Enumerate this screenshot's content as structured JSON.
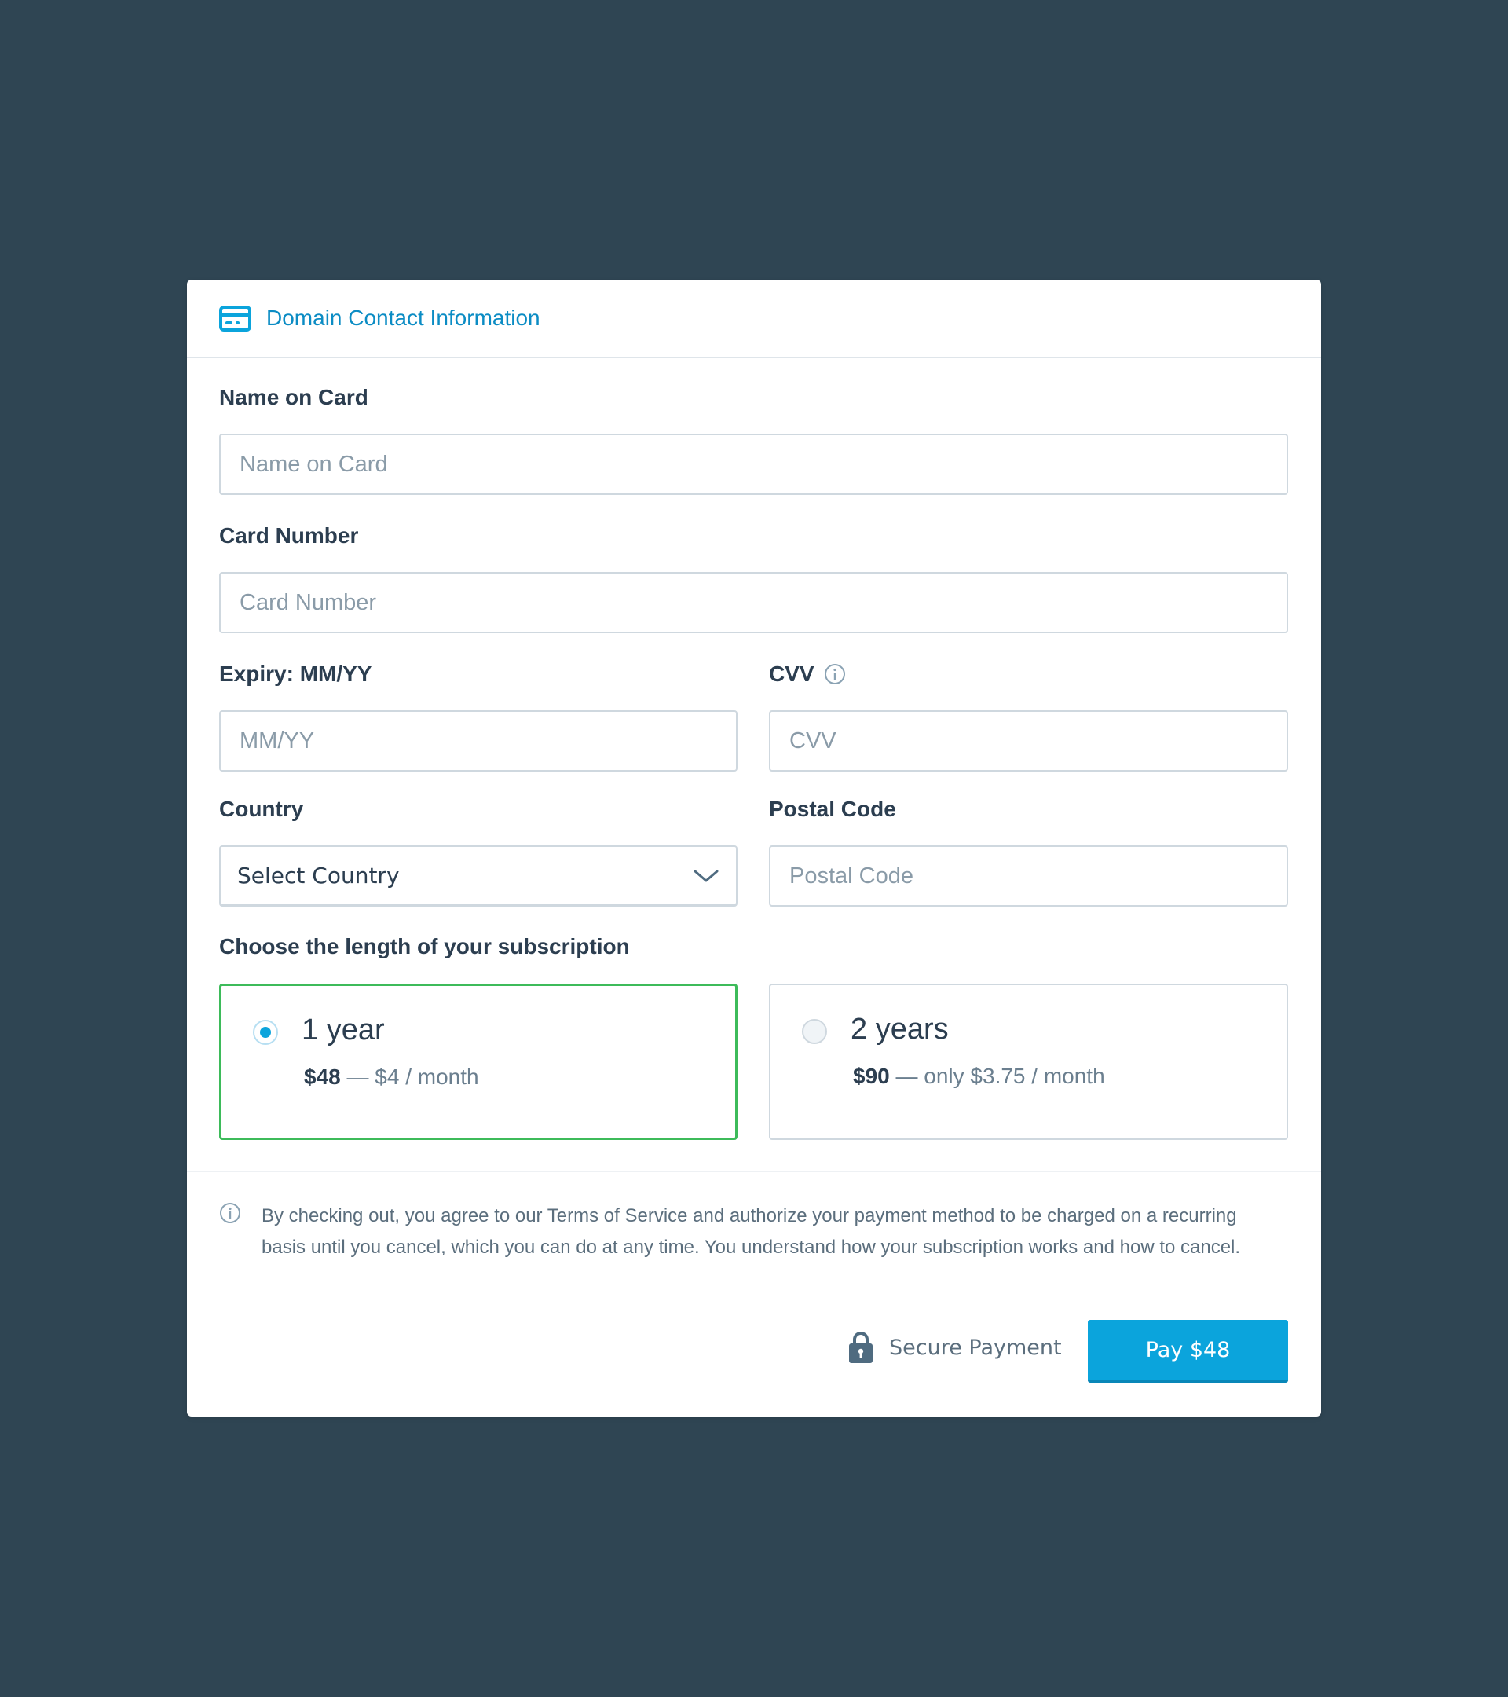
{
  "header": {
    "title": "Domain Contact Information",
    "icon": "credit-card-icon"
  },
  "form": {
    "name_on_card": {
      "label": "Name on Card",
      "placeholder": "Name on Card",
      "value": ""
    },
    "card_number": {
      "label": "Card Number",
      "placeholder": "Card Number",
      "value": ""
    },
    "expiry": {
      "label": "Expiry: MM/YY",
      "placeholder": "MM/YY",
      "value": ""
    },
    "cvv": {
      "label": "CVV",
      "placeholder": "CVV",
      "value": "",
      "icon": "info-icon"
    },
    "country": {
      "label": "Country",
      "selected": "Select Country",
      "icon": "chevron-down-icon"
    },
    "postal_code": {
      "label": "Postal Code",
      "placeholder": "Postal Code",
      "value": ""
    }
  },
  "subscription": {
    "label": "Choose the length of your subscription",
    "plans": [
      {
        "title": "1 year",
        "amount": "$48",
        "separator": " — ",
        "detail": "$4 / month",
        "selected": true
      },
      {
        "title": "2 years",
        "amount": "$90",
        "separator": " — ",
        "detail": "only $3.75 / month",
        "selected": false
      }
    ]
  },
  "notice": {
    "icon": "info-icon",
    "text": "By checking out, you agree to our Terms of Service and authorize your payment method to be charged on a recurring basis until you cancel, which you can do at any time. You understand how your subscription works and how to cancel."
  },
  "footer": {
    "secure_label": "Secure Payment",
    "secure_icon": "lock-icon",
    "pay_label": "Pay $48"
  },
  "colors": {
    "background": "#2f4553",
    "accent": "#0ba4dc",
    "header_text": "#0b8cc4",
    "selected_border": "#3dbb5a"
  }
}
